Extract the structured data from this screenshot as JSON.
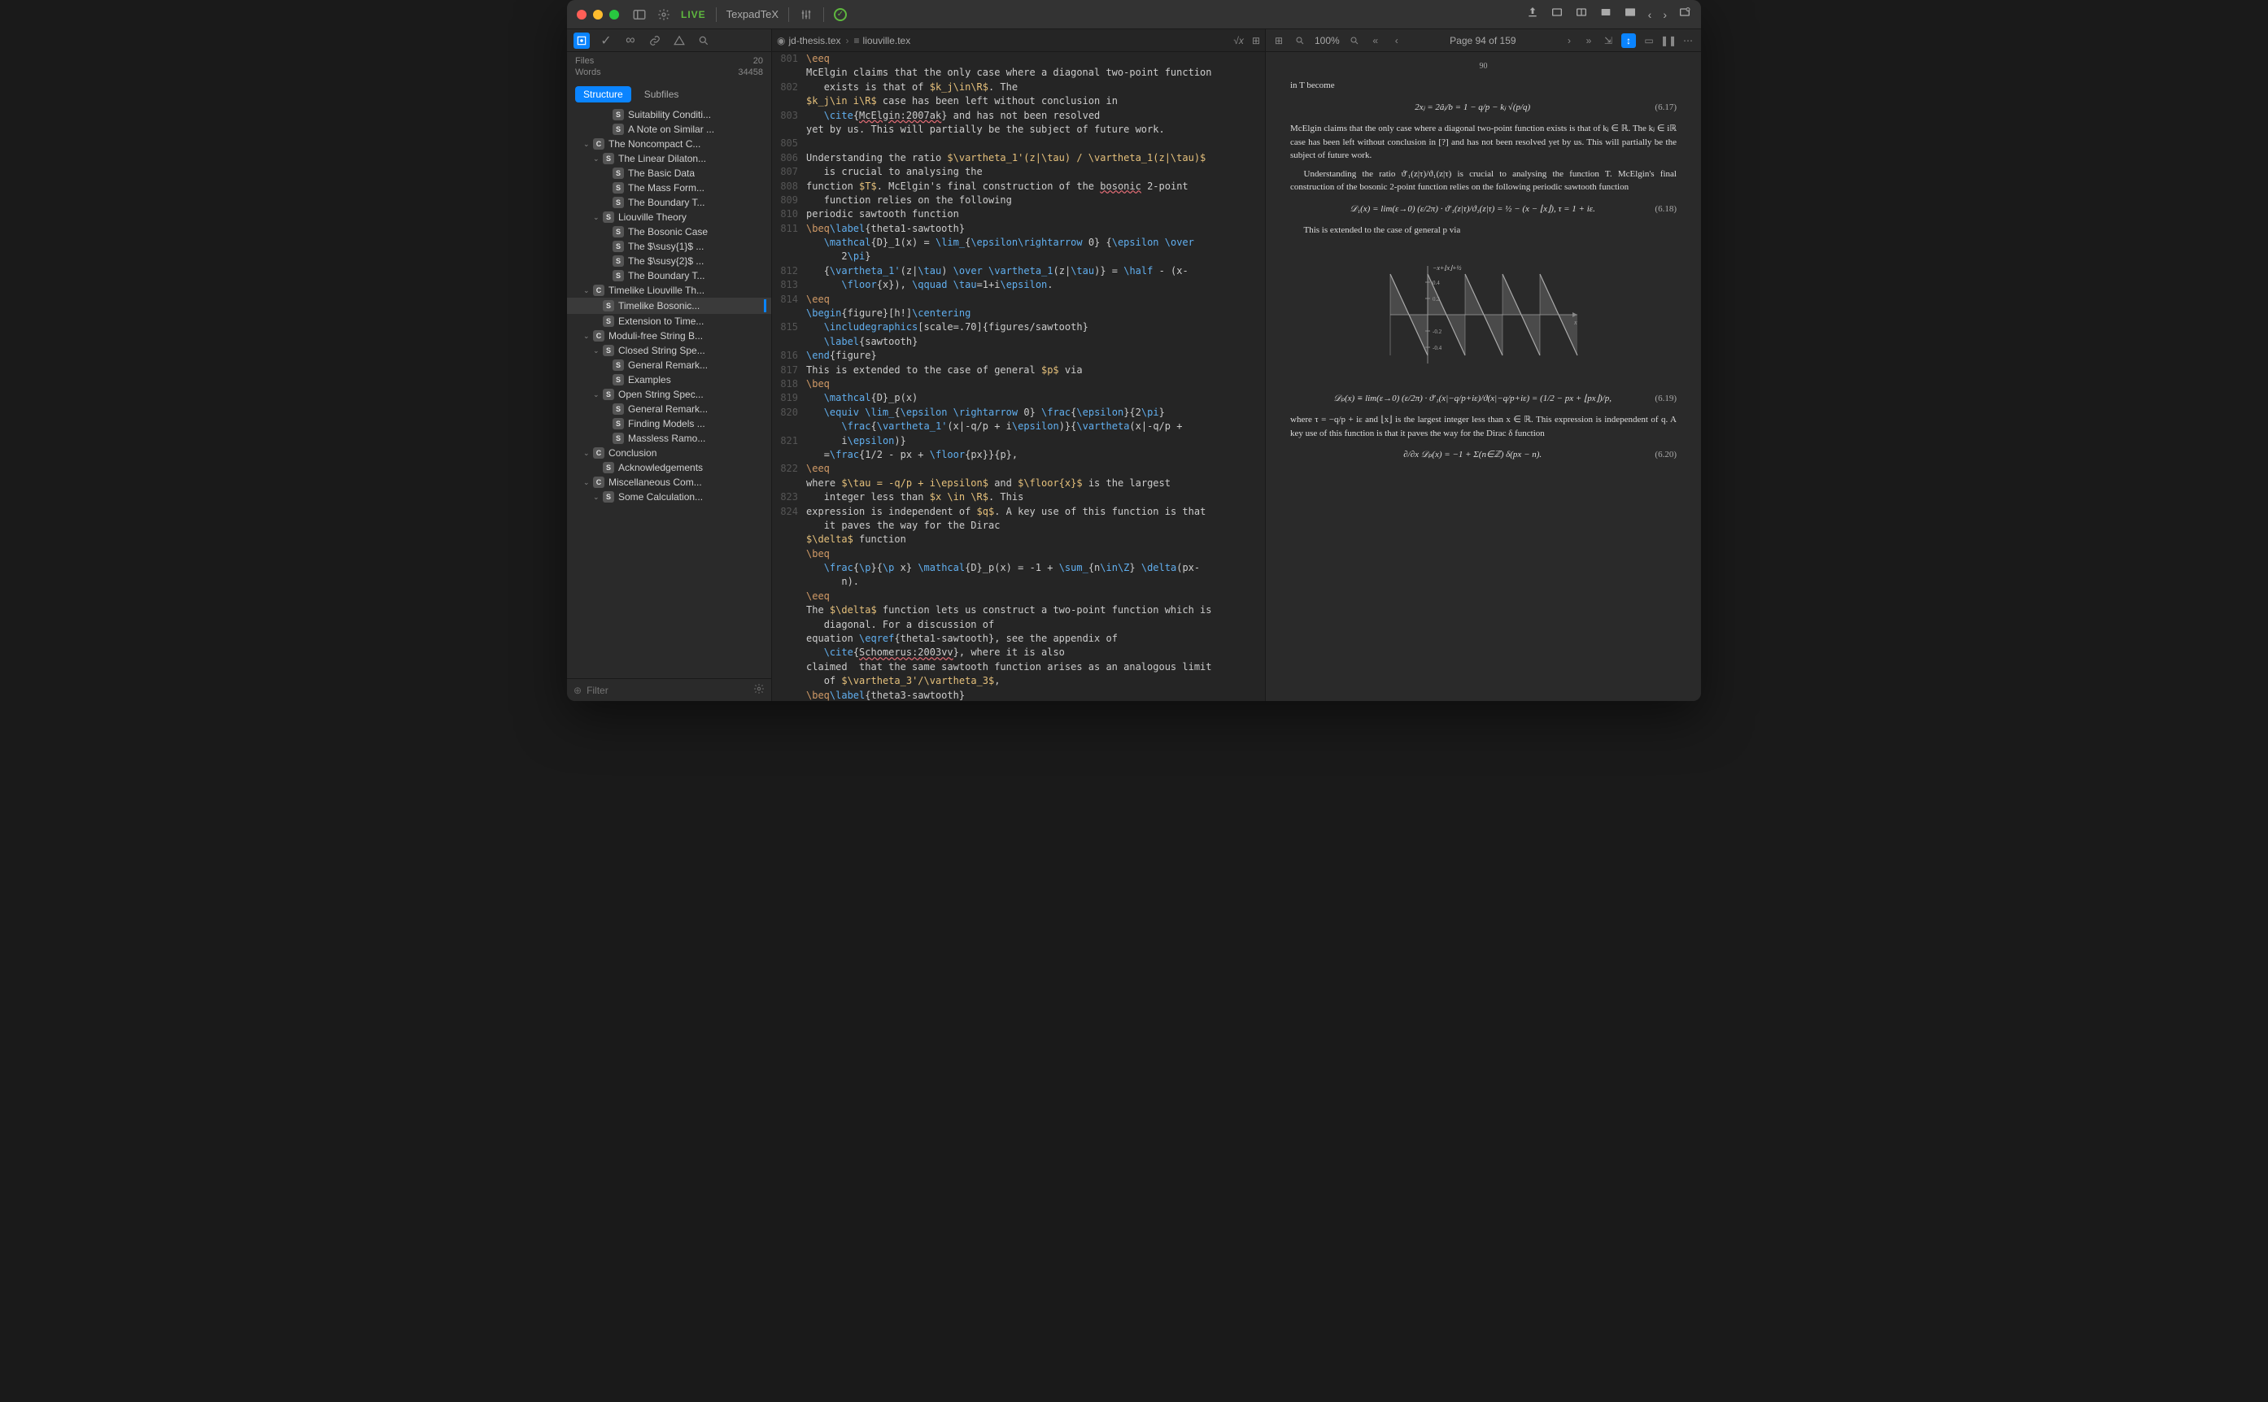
{
  "titlebar": {
    "live": "LIVE",
    "engine": "TexpadTeX"
  },
  "sidebar": {
    "stats": {
      "files_label": "Files",
      "files_count": "20",
      "words_label": "Words",
      "words_count": "34458"
    },
    "tabs": {
      "structure": "Structure",
      "subfiles": "Subfiles"
    },
    "outline": [
      {
        "depth": 3,
        "badge": "S",
        "label": "Suitability Conditi..."
      },
      {
        "depth": 3,
        "badge": "S",
        "label": "A Note on Similar ..."
      },
      {
        "depth": 1,
        "chev": "⌄",
        "badge": "C",
        "label": "The Noncompact C..."
      },
      {
        "depth": 2,
        "chev": "⌄",
        "badge": "S",
        "label": "The Linear Dilaton..."
      },
      {
        "depth": 3,
        "badge": "S",
        "label": "The Basic Data"
      },
      {
        "depth": 3,
        "badge": "S",
        "label": "The Mass Form..."
      },
      {
        "depth": 3,
        "badge": "S",
        "label": "The Boundary T..."
      },
      {
        "depth": 2,
        "chev": "⌄",
        "badge": "S",
        "label": "Liouville Theory"
      },
      {
        "depth": 3,
        "badge": "S",
        "label": "The Bosonic Case"
      },
      {
        "depth": 3,
        "badge": "S",
        "label": "The $\\susy{1}$ ..."
      },
      {
        "depth": 3,
        "badge": "S",
        "label": "The $\\susy{2}$ ..."
      },
      {
        "depth": 3,
        "badge": "S",
        "label": "The Boundary T..."
      },
      {
        "depth": 1,
        "chev": "⌄",
        "badge": "C",
        "label": "Timelike Liouville Th..."
      },
      {
        "depth": 2,
        "badge": "S",
        "label": "Timelike Bosonic...",
        "selected": true
      },
      {
        "depth": 2,
        "badge": "S",
        "label": "Extension to Time..."
      },
      {
        "depth": 1,
        "chev": "⌄",
        "badge": "C",
        "label": "Moduli-free String B..."
      },
      {
        "depth": 2,
        "chev": "⌄",
        "badge": "S",
        "label": "Closed String Spe..."
      },
      {
        "depth": 3,
        "badge": "S",
        "label": "General Remark..."
      },
      {
        "depth": 3,
        "badge": "S",
        "label": "Examples"
      },
      {
        "depth": 2,
        "chev": "⌄",
        "badge": "S",
        "label": "Open String Spec..."
      },
      {
        "depth": 3,
        "badge": "S",
        "label": "General Remark..."
      },
      {
        "depth": 3,
        "badge": "S",
        "label": "Finding Models ..."
      },
      {
        "depth": 3,
        "badge": "S",
        "label": "Massless Ramo..."
      },
      {
        "depth": 1,
        "chev": "⌄",
        "badge": "C",
        "label": "Conclusion"
      },
      {
        "depth": 2,
        "badge": "S",
        "label": "Acknowledgements"
      },
      {
        "depth": 1,
        "chev": "⌄",
        "badge": "C",
        "label": "Miscellaneous Com..."
      },
      {
        "depth": 2,
        "chev": "⌄",
        "badge": "S",
        "label": "Some Calculation..."
      }
    ],
    "filter_placeholder": "Filter"
  },
  "editor": {
    "breadcrumb": {
      "root": "jd-thesis.tex",
      "current": "liouville.tex"
    },
    "start_line": 801,
    "lines": [
      {
        "n": 801,
        "html": "<span class='tk-cmd'>\\eeq</span>"
      },
      {
        "n": null,
        "html": "McElgin claims that the only case where a diagonal two-point function"
      },
      {
        "n": 802,
        "html": "   exists is that of <span class='tk-math'>$k_j\\in\\R$</span>. The"
      },
      {
        "n": null,
        "html": "<span class='tk-math'>$k_j\\in i\\R$</span> case has been left without conclusion in"
      },
      {
        "n": 803,
        "html": "   <span class='tk-kw'>\\cite</span>{<span class='tk-err'>McElgin:2007ak</span>} and has not been resolved"
      },
      {
        "n": null,
        "html": "yet by us. This will partially be the subject of future work."
      },
      {
        "n": 805,
        "html": ""
      },
      {
        "n": 806,
        "html": "Understanding the ratio <span class='tk-math'>$\\vartheta_1'(z|\\tau) / \\vartheta_1(z|\\tau)$</span>"
      },
      {
        "n": 807,
        "html": "   is crucial to analysing the"
      },
      {
        "n": 808,
        "html": "function <span class='tk-math'>$T$</span>. McElgin's final construction of the <span class='tk-err'>bosonic</span> 2-point"
      },
      {
        "n": 809,
        "html": "   function relies on the following"
      },
      {
        "n": 810,
        "html": "periodic sawtooth function"
      },
      {
        "n": 811,
        "html": "<span class='tk-cmd'>\\beq</span><span class='tk-kw'>\\label</span>{theta1-sawtooth}"
      },
      {
        "n": null,
        "html": "   <span class='tk-kw'>\\mathcal</span>{D}_1(x) = <span class='tk-kw'>\\lim_</span>{<span class='tk-kw'>\\epsilon\\rightarrow</span> 0} {<span class='tk-kw'>\\epsilon \\over</span>"
      },
      {
        "n": null,
        "html": "      2<span class='tk-kw'>\\pi</span>}"
      },
      {
        "n": 812,
        "html": "   {<span class='tk-kw'>\\vartheta_1'</span>(z|<span class='tk-kw'>\\tau</span>) <span class='tk-kw'>\\over \\vartheta_1</span>(z|<span class='tk-kw'>\\tau</span>)} = <span class='tk-kw'>\\half</span> - (x-"
      },
      {
        "n": 813,
        "html": "      <span class='tk-kw'>\\floor</span>{x}), <span class='tk-kw'>\\qquad \\tau</span>=1+i<span class='tk-kw'>\\epsilon</span>."
      },
      {
        "n": 814,
        "html": "<span class='tk-cmd'>\\eeq</span>"
      },
      {
        "n": null,
        "html": "<span class='tk-kw'>\\begin</span>{figure}[h!]<span class='tk-kw'>\\centering</span>"
      },
      {
        "n": 815,
        "html": "   <span class='tk-kw'>\\includegraphics</span>[scale=.70]{figures/sawtooth}"
      },
      {
        "n": null,
        "html": "   <span class='tk-kw'>\\label</span>{sawtooth}"
      },
      {
        "n": 816,
        "html": "<span class='tk-kw'>\\end</span>{figure}"
      },
      {
        "n": 817,
        "html": "This is extended to the case of general <span class='tk-math'>$p$</span> via"
      },
      {
        "n": 818,
        "html": "<span class='tk-cmd'>\\beq</span>"
      },
      {
        "n": 819,
        "html": "   <span class='tk-kw'>\\mathcal</span>{D}_p(x)"
      },
      {
        "n": 820,
        "html": "   <span class='tk-kw'>\\equiv \\lim_</span>{<span class='tk-kw'>\\epsilon \\rightarrow</span> 0} <span class='tk-kw'>\\frac</span>{<span class='tk-kw'>\\epsilon</span>}{2<span class='tk-kw'>\\pi</span>}"
      },
      {
        "n": null,
        "html": "      <span class='tk-kw'>\\frac</span>{<span class='tk-kw'>\\vartheta_1'</span>(x|-q/p + i<span class='tk-kw'>\\epsilon</span>)}{<span class='tk-kw'>\\vartheta</span>(x|-q/p +"
      },
      {
        "n": 821,
        "html": "      i<span class='tk-kw'>\\epsilon</span>)}"
      },
      {
        "n": null,
        "html": "   =<span class='tk-kw'>\\frac</span>{1/2 - px + <span class='tk-kw'>\\floor</span>{px}}{p},"
      },
      {
        "n": 822,
        "html": "<span class='tk-cmd'>\\eeq</span>"
      },
      {
        "n": null,
        "html": "where <span class='tk-math'>$\\tau = -q/p + i\\epsilon$</span> and <span class='tk-math'>$\\floor{x}$</span> is the largest"
      },
      {
        "n": 823,
        "html": "   integer less than <span class='tk-math'>$x \\in \\R$</span>. This"
      },
      {
        "n": 824,
        "html": "expression is independent of <span class='tk-math'>$q$</span>. A key use of this function is that"
      },
      {
        "n": null,
        "html": "   it paves the way for the Dirac"
      },
      {
        "n": null,
        "html": "<span class='tk-math'>$\\delta$</span> function"
      },
      {
        "n": null,
        "html": "<span class='tk-cmd'>\\beq</span>"
      },
      {
        "n": null,
        "html": "   <span class='tk-kw'>\\frac</span>{<span class='tk-kw'>\\p</span>}{<span class='tk-kw'>\\p</span> x} <span class='tk-kw'>\\mathcal</span>{D}_p(x) = -1 + <span class='tk-kw'>\\sum_</span>{n<span class='tk-kw'>\\in\\Z</span>} <span class='tk-kw'>\\delta</span>(px-"
      },
      {
        "n": null,
        "html": "      n)."
      },
      {
        "n": null,
        "html": "<span class='tk-cmd'>\\eeq</span>"
      },
      {
        "n": null,
        "html": "The <span class='tk-math'>$\\delta$</span> function lets us construct a two-point function which is"
      },
      {
        "n": null,
        "html": "   diagonal. For a discussion of"
      },
      {
        "n": null,
        "html": "equation <span class='tk-kw'>\\eqref</span>{theta1-sawtooth}, see the appendix of"
      },
      {
        "n": null,
        "html": "   <span class='tk-kw'>\\cite</span>{<span class='tk-err'>Schomerus:2003vv</span>}, where it is also"
      },
      {
        "n": null,
        "html": "claimed  that the same sawtooth function arises as an analogous limit"
      },
      {
        "n": null,
        "html": "   of <span class='tk-math'>$\\vartheta_3'/\\vartheta_3$</span>,"
      },
      {
        "n": null,
        "html": "<span class='tk-cmd'>\\beq</span><span class='tk-kw'>\\label</span>{theta3-sawtooth}"
      }
    ]
  },
  "preview": {
    "zoom": "100%",
    "page_status": "Page 94 of 159",
    "page_number": "90",
    "para0": "in T become",
    "eq1": "2xⱼ = 2âⱼ/b = 1 − q/p − kⱼ √(p/q)",
    "eq1_no": "(6.17)",
    "para1": "McElgin claims that the only case where a diagonal two-point function exists is that of kⱼ ∈ ℝ. The kⱼ ∈ iℝ case has been left without conclusion in [?] and has not been resolved yet by us. This will partially be the subject of future work.",
    "para2": "Understanding the ratio ϑ′₁(z|τ)/ϑ₁(z|τ) is crucial to analysing the function T. McElgin's final construction of the bosonic 2-point function relies on the following periodic sawtooth function",
    "eq2": "𝒟₁(x) = lim(ε→0) (ε/2π) · ϑ′₁(z|τ)/ϑ₁(z|τ) = ½ − (x − ⌊x⌋),    τ = 1 + iε.",
    "eq2_no": "(6.18)",
    "para3": "This is extended to the case of general p via",
    "eq3": "𝒟ₚ(x) ≡ lim(ε→0) (ε/2π) · ϑ′₁(x|−q/p+iε)/ϑ(x|−q/p+iε) = (1/2 − px + ⌊px⌋)/p,",
    "eq3_no": "(6.19)",
    "para4": "where τ = −q/p + iε and ⌊x⌋ is the largest integer less than x ∈ ℝ. This expression is independent of q. A key use of this function is that it paves the way for the Dirac δ function",
    "eq4": "∂/∂x 𝒟ₚ(x) = −1 + Σ(n∈ℤ) δ(px − n).",
    "eq4_no": "(6.20)"
  },
  "chart_data": {
    "type": "line",
    "title": "",
    "xlabel": "x",
    "ylabel": "",
    "xlim": [
      -1,
      4
    ],
    "ylim": [
      -0.6,
      0.6
    ],
    "yticks": [
      -0.4,
      -0.2,
      0.2,
      0.4
    ],
    "annotation": "−x+⌊x⌋+½",
    "series": [
      {
        "name": "sawtooth",
        "segments": [
          {
            "x": [
              -1,
              0
            ],
            "y": [
              0.5,
              -0.5
            ]
          },
          {
            "x": [
              0,
              1
            ],
            "y": [
              0.5,
              -0.5
            ]
          },
          {
            "x": [
              1,
              2
            ],
            "y": [
              0.5,
              -0.5
            ]
          },
          {
            "x": [
              2,
              3
            ],
            "y": [
              0.5,
              -0.5
            ]
          },
          {
            "x": [
              3,
              4
            ],
            "y": [
              0.5,
              -0.5
            ]
          }
        ]
      }
    ]
  }
}
